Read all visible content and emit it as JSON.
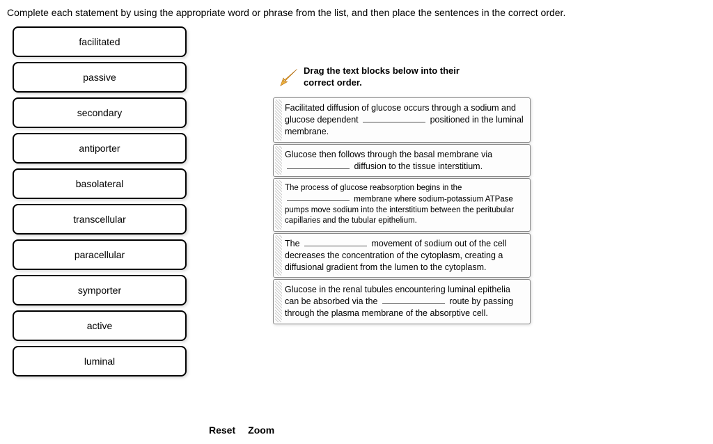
{
  "instruction": "Complete each statement by using the appropriate word or phrase from the list, and then place the sentences in the correct order.",
  "word_bank": [
    "facilitated",
    "passive",
    "secondary",
    "antiporter",
    "basolateral",
    "transcellular",
    "paracellular",
    "symporter",
    "active",
    "luminal"
  ],
  "drop_header": "Drag the text blocks below into their correct order.",
  "statements": {
    "s1": {
      "p1": "Facilitated diffusion of glucose occurs through a sodium and glucose dependent ",
      "p2": " positioned in the luminal membrane."
    },
    "s2": {
      "p1": "Glucose then follows through the basal membrane via ",
      "p2": " diffusion to the tissue interstitium."
    },
    "s3": {
      "p1": "The process of glucose reabsorption begins in the ",
      "p2": " membrane where sodium-potassium ATPase pumps move sodium into the interstitium between the peritubular capillaries and the tubular epithelium."
    },
    "s4": {
      "p1": "The ",
      "p2": " movement of sodium out of the cell decreases the concentration of the cytoplasm, creating a diffusional gradient from the lumen to the cytoplasm."
    },
    "s5": {
      "p1": "Glucose in the renal tubules encountering luminal epithelia can be absorbed via the ",
      "p2": " route by passing through the plasma membrane of the absorptive cell."
    }
  },
  "buttons": {
    "reset": "Reset",
    "zoom": "Zoom"
  }
}
